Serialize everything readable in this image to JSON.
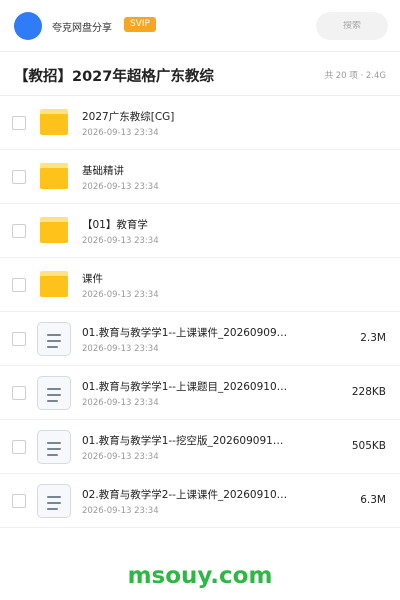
{
  "header": {
    "username": "夸克网盘分享",
    "badge": "SVIP",
    "search_placeholder": "搜索"
  },
  "share": {
    "title": "【教招】2027年超格广东教综",
    "meta": "共 20 项 · 2.4G"
  },
  "files": [
    {
      "type": "folder",
      "name": "2027广东教综[CG]",
      "date": "2026-09-13 23:34",
      "size": ""
    },
    {
      "type": "folder",
      "name": "基础精讲",
      "date": "2026-09-13 23:34",
      "size": ""
    },
    {
      "type": "folder",
      "name": "【01】教育学",
      "date": "2026-09-13 23:34",
      "size": ""
    },
    {
      "type": "folder",
      "name": "课件",
      "date": "2026-09-13 23:34",
      "size": ""
    },
    {
      "type": "file",
      "name": "01.教育与教学学1--上课课件_20260909…",
      "date": "2026-09-13 23:34",
      "size": "2.3M"
    },
    {
      "type": "file",
      "name": "01.教育与教学学1--上课题目_20260910…",
      "date": "2026-09-13 23:34",
      "size": "228KB"
    },
    {
      "type": "file",
      "name": "01.教育与教学学1--挖空版_202609091…",
      "date": "2026-09-13 23:34",
      "size": "505KB"
    },
    {
      "type": "file",
      "name": "02.教育与教学学2--上课课件_20260910…",
      "date": "2026-09-13 23:34",
      "size": "6.3M"
    }
  ],
  "watermark": "msouy.com",
  "colors": {
    "avatar": "#2f7cf6",
    "svip_badge": "#f5a623",
    "folder": "#ffc21a",
    "watermark": "#2db844"
  }
}
